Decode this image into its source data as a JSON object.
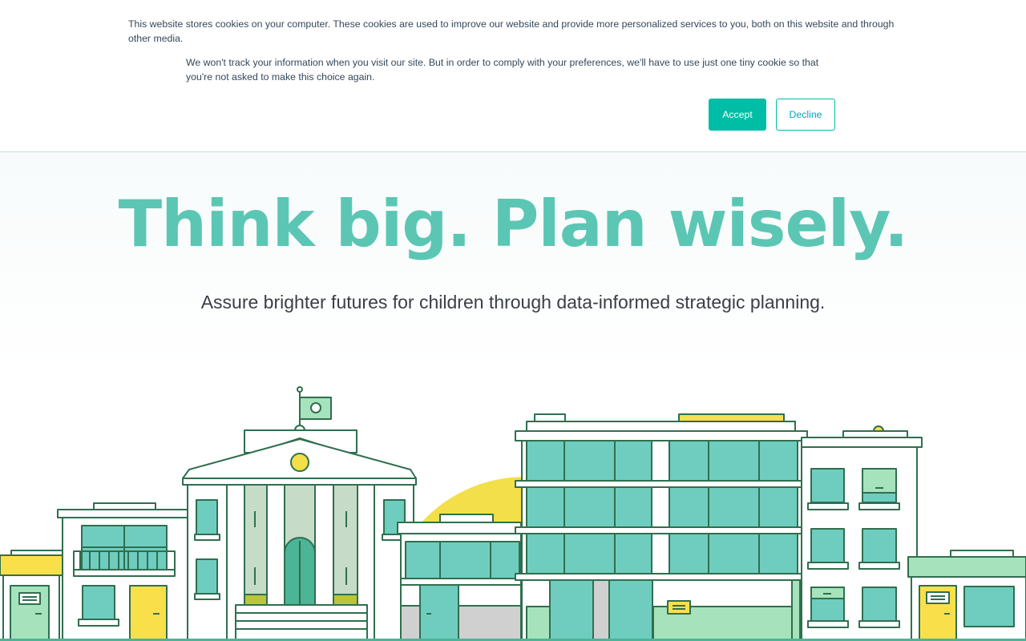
{
  "cookie_banner": {
    "text": "This website stores cookies on your computer. These cookies are used to improve our website and provide more personalized services to you, both on this website and through other media.",
    "secondary_text": "We won't track your information when you visit our site. But in order to comply with your preferences, we'll have to use just one tiny cookie so that you're not asked to make this choice again.",
    "accept_label": "Accept",
    "decline_label": "Decline"
  },
  "hero": {
    "title": "Think big. Plan wisely.",
    "subtitle": "Assure brighter futures for children through data-informed strategic planning."
  },
  "colors": {
    "accent": "#00bda5",
    "title": "#5cc6b4",
    "building_outline": "#2f6f4e",
    "window_fill": "#6fcdbf",
    "sun": "#f2df4a"
  },
  "illustration": {
    "elements": [
      "school-building",
      "office-building",
      "apartment-building",
      "house",
      "sun",
      "flag"
    ]
  }
}
